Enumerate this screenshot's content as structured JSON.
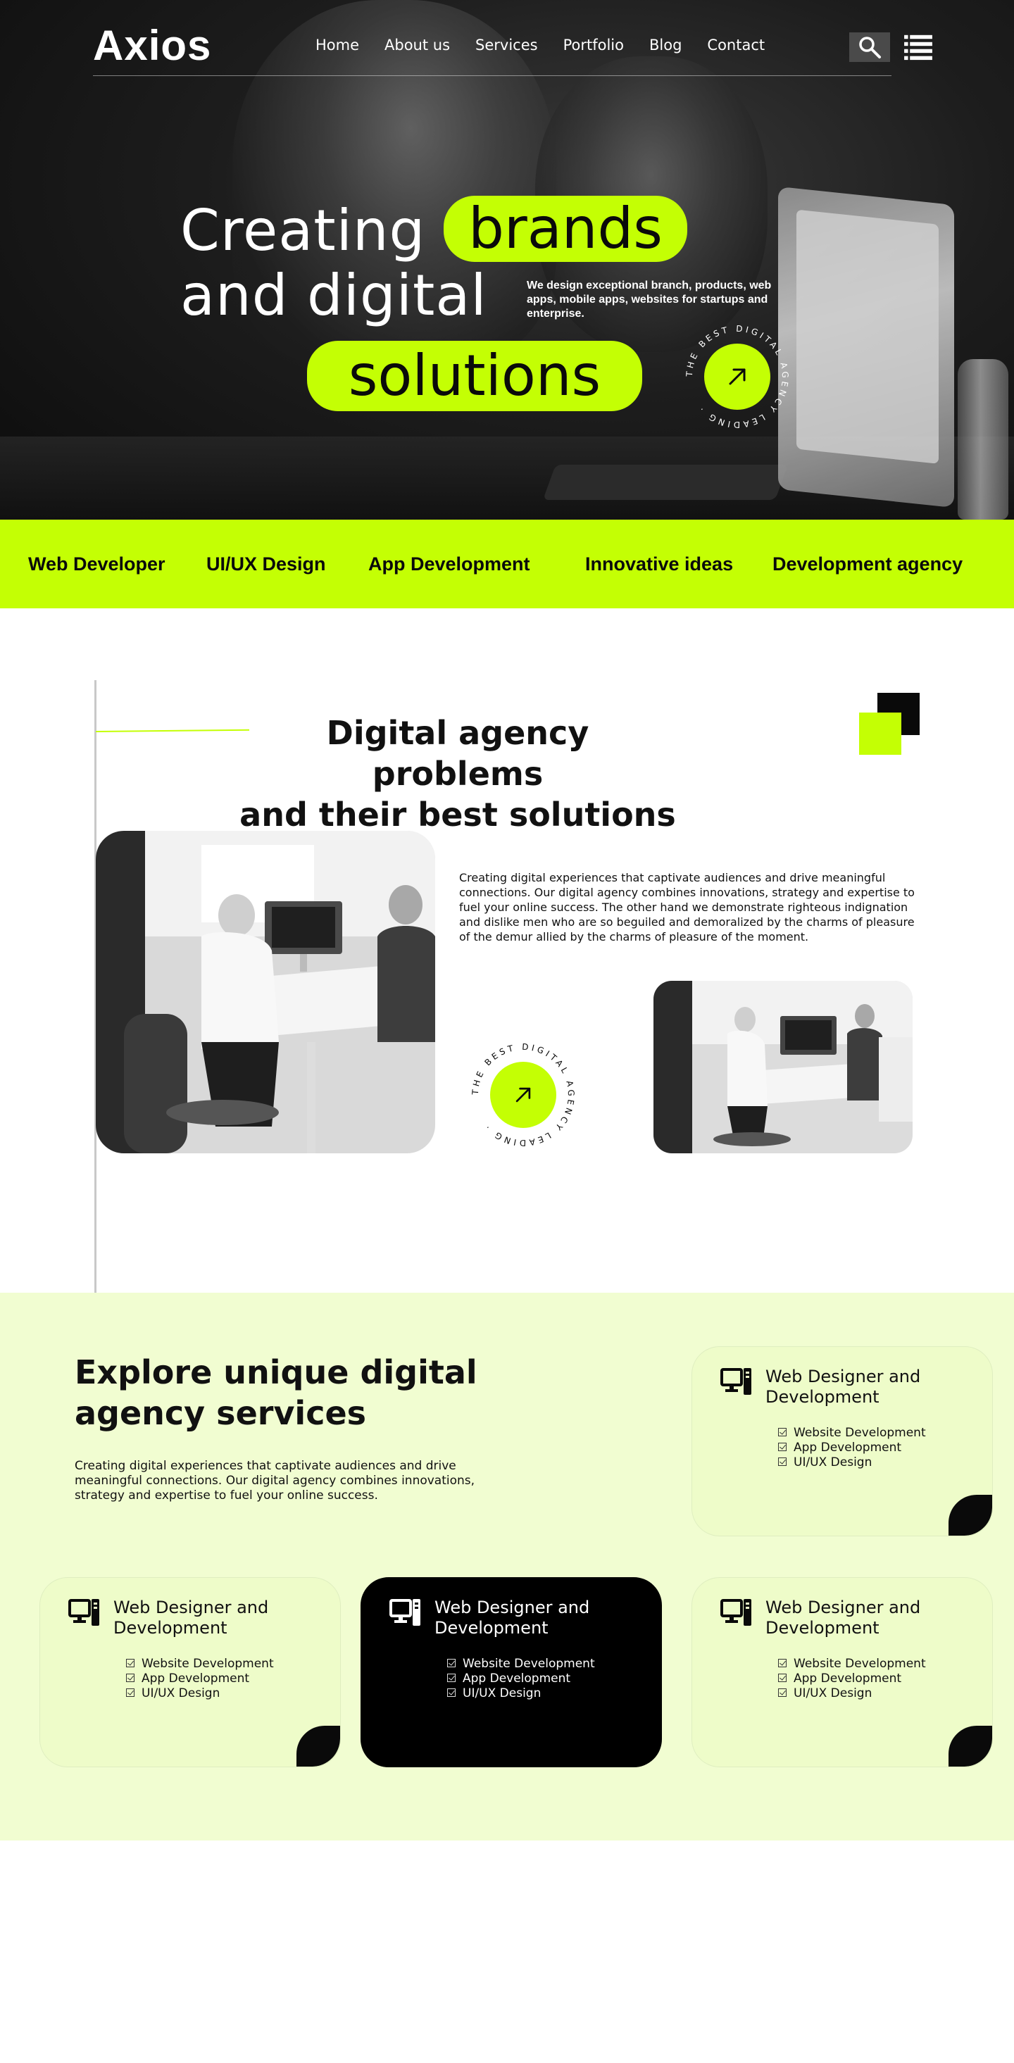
{
  "nav": {
    "logo": "Axios",
    "items": [
      "Home",
      "About us",
      "Services",
      "Portfolio",
      "Blog",
      "Contact"
    ]
  },
  "hero": {
    "line1": "Creating",
    "pill1": "brands",
    "line2": "and  digital",
    "pill2": "solutions",
    "description": "We design exceptional branch, products, web apps, mobile apps, websites for startups and enterprise.",
    "badge_text": "THE BEST DIGITAL AGENCY LEADING ·"
  },
  "strip": {
    "items": [
      "Web Developer",
      "UI/UX Design",
      "App Development",
      "Innovative ideas",
      "Development agency"
    ]
  },
  "problems": {
    "title_line1": "Digital agency problems",
    "title_line2": "and their best solutions",
    "body": "Creating digital experiences that captivate audiences and drive meaningful connections. Our digital agency combines innovations, strategy and expertise to fuel your online success. The other hand we demonstrate righteous indignation and dislike men who are so beguiled and demoralized by the charms of pleasure of the demur allied by the charms of pleasure of the moment.",
    "badge_text": "THE BEST DIGITAL AGENCY LEADING ·"
  },
  "services": {
    "title_line1": "Explore unique digital",
    "title_line2": "agency services",
    "description": "Creating digital experiences that captivate audiences and drive meaningful connections. Our digital agency combines innovations, strategy and expertise to fuel your online success.",
    "cards": [
      {
        "title": "Web Designer and Development",
        "items": [
          "Website Development",
          "App Development",
          "UI/UX Design"
        ]
      },
      {
        "title": "Web Designer and Development",
        "items": [
          "Website Development",
          "App Development",
          "UI/UX Design"
        ]
      },
      {
        "title": "Web Designer and Development",
        "items": [
          "Website Development",
          "App Development",
          "UI/UX Design"
        ]
      },
      {
        "title": "Web Designer and Development",
        "items": [
          "Website Development",
          "App Development",
          "UI/UX Design"
        ]
      }
    ]
  },
  "colors": {
    "accent": "#c4ff04",
    "dark": "#0a0a0a",
    "services_bg": "#f1fdd1"
  },
  "icons": [
    "search-icon",
    "menu-icon",
    "arrow-up-right-icon",
    "computer-icon",
    "checkbox-icon"
  ]
}
